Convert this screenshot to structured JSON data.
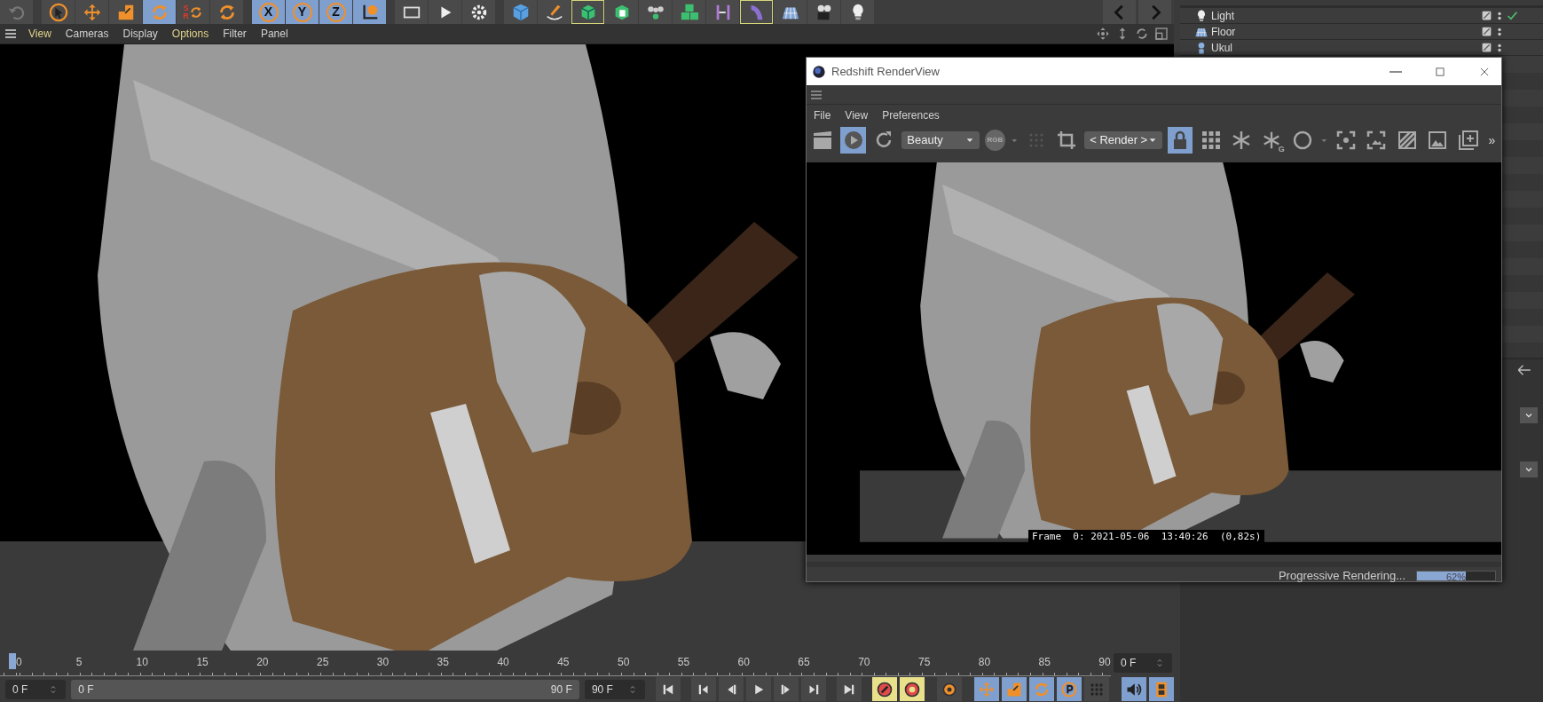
{
  "main_toolbar": {
    "groups": [
      {
        "tools": [
          {
            "kind": "tool",
            "active": false,
            "outlined": false
          }
        ]
      },
      {
        "tools": [
          {
            "kind": "tool",
            "active": false,
            "outlined": false
          },
          {
            "kind": "tool",
            "active": false,
            "outlined": false
          },
          {
            "kind": "tool",
            "active": false,
            "outlined": false
          },
          {
            "kind": "tool",
            "active": true,
            "outlined": false
          },
          {
            "kind": "labeled",
            "label": "SR",
            "active": false,
            "outlined": false
          },
          {
            "kind": "tool",
            "active": false,
            "outlined": false
          }
        ]
      },
      {
        "tools": [
          {
            "kind": "axis",
            "label": "X",
            "active": true,
            "outlined": false
          },
          {
            "kind": "axis",
            "label": "Y",
            "active": true,
            "outlined": false
          },
          {
            "kind": "axis",
            "label": "Z",
            "active": true,
            "outlined": false
          },
          {
            "kind": "tool",
            "active": true,
            "outlined": false
          }
        ]
      },
      {
        "tools": [
          {
            "kind": "tool",
            "active": false,
            "outlined": false
          },
          {
            "kind": "tool",
            "active": false,
            "outlined": false
          },
          {
            "kind": "tool",
            "active": false,
            "outlined": false
          }
        ]
      },
      {
        "tools": [
          {
            "kind": "tool",
            "active": false,
            "outlined": false
          },
          {
            "kind": "tool",
            "active": false,
            "outlined": false
          },
          {
            "kind": "tool",
            "active": false,
            "outlined": true
          },
          {
            "kind": "tool",
            "active": false,
            "outlined": false
          },
          {
            "kind": "tool",
            "active": false,
            "outlined": false
          },
          {
            "kind": "tool",
            "active": false,
            "outlined": false
          },
          {
            "kind": "tool",
            "active": false,
            "outlined": false
          },
          {
            "kind": "tool",
            "active": false,
            "outlined": true
          },
          {
            "kind": "tool",
            "active": false,
            "outlined": false
          },
          {
            "kind": "tool",
            "active": false,
            "outlined": false
          },
          {
            "kind": "tool",
            "active": false,
            "outlined": false
          }
        ]
      }
    ]
  },
  "viewport": {
    "menu": [
      {
        "label": "View",
        "highlighted": true
      },
      {
        "label": "Cameras",
        "highlighted": false
      },
      {
        "label": "Display",
        "highlighted": false
      },
      {
        "label": "Options",
        "highlighted": true
      },
      {
        "label": "Filter",
        "highlighted": false
      },
      {
        "label": "Panel",
        "highlighted": false
      }
    ]
  },
  "object_manager": {
    "objects": [
      {
        "name": "Light",
        "kind": "light",
        "tagged": true
      },
      {
        "name": "Floor",
        "kind": "floor",
        "tagged": false
      },
      {
        "name": "Ukul",
        "kind": "null",
        "tagged": false
      }
    ]
  },
  "render_view": {
    "title": "Redshift RenderView",
    "menu": [
      "File",
      "View",
      "Preferences"
    ],
    "toolbar": [
      {
        "kind": "tool",
        "active": false,
        "disabled": false
      },
      {
        "kind": "tool",
        "active": true,
        "disabled": false
      },
      {
        "kind": "tool",
        "active": false,
        "disabled": false
      },
      {
        "kind": "dropdown",
        "label": "Beauty"
      },
      {
        "kind": "label",
        "label": "RGB"
      },
      {
        "kind": "caret"
      },
      {
        "kind": "tool",
        "active": false,
        "disabled": true
      },
      {
        "kind": "tool",
        "active": false,
        "disabled": false
      },
      {
        "kind": "dropdown",
        "label": "< Render >"
      },
      {
        "kind": "tool",
        "active": true,
        "disabled": false
      },
      {
        "kind": "tool",
        "active": false,
        "disabled": false
      },
      {
        "kind": "tool",
        "active": false,
        "disabled": false
      },
      {
        "kind": "sub",
        "label": "G"
      },
      {
        "kind": "tool",
        "active": false,
        "disabled": false
      },
      {
        "kind": "caret"
      },
      {
        "kind": "tool",
        "active": false,
        "disabled": false
      },
      {
        "kind": "tool",
        "active": false,
        "disabled": false
      },
      {
        "kind": "tool",
        "active": false,
        "disabled": false
      },
      {
        "kind": "tool",
        "active": false,
        "disabled": false
      },
      {
        "kind": "tool",
        "active": false,
        "disabled": false
      },
      {
        "kind": "more",
        "label": "»"
      }
    ],
    "frame_info": "Frame  0: 2021-05-06  13:40:26  (0,82s)",
    "status": "Progressive Rendering...",
    "progress": {
      "level": 0.62,
      "label": "62%"
    }
  },
  "timeline": {
    "ticks": [
      "0",
      "5",
      "10",
      "15",
      "20",
      "25",
      "30",
      "35",
      "40",
      "45",
      "50",
      "55",
      "60",
      "65",
      "70",
      "75",
      "80",
      "85",
      "90"
    ],
    "current_frame": "0 F",
    "start": "0 F",
    "range_start": "0 F",
    "range_end": "90 F",
    "end": "90 F",
    "transport": [
      {
        "kind": "first"
      },
      {
        "kind": "prev_key"
      },
      {
        "kind": "prev_frame"
      },
      {
        "kind": "play"
      },
      {
        "kind": "next_frame"
      },
      {
        "kind": "next_key"
      },
      {
        "kind": "last"
      }
    ],
    "tools": [
      {
        "kind": "record",
        "active": true
      },
      {
        "kind": "autokey",
        "active": true
      },
      {
        "kind": "keygear",
        "active": false
      },
      {
        "kind": "move",
        "active": true
      },
      {
        "kind": "scale",
        "active": true
      },
      {
        "kind": "rotate",
        "active": true
      },
      {
        "kind": "param",
        "active": true
      },
      {
        "kind": "dots",
        "active": false
      },
      {
        "kind": "sound",
        "active": true
      },
      {
        "kind": "film",
        "active": true
      }
    ]
  }
}
